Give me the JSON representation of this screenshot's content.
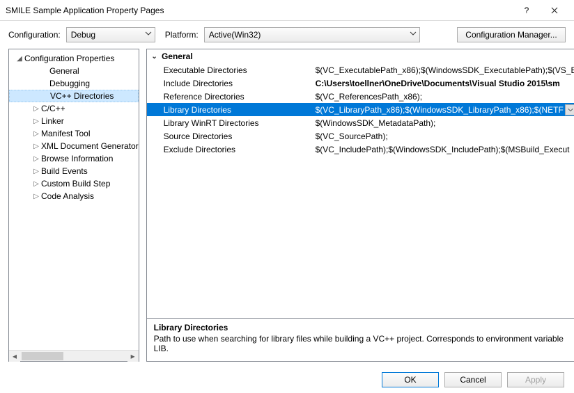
{
  "title": "SMILE Sample Application Property Pages",
  "toolbar": {
    "configuration_label": "Configuration:",
    "configuration_value": "Debug",
    "platform_label": "Platform:",
    "platform_value": "Active(Win32)",
    "config_manager": "Configuration Manager..."
  },
  "tree": {
    "root": "Configuration Properties",
    "items": [
      {
        "label": "General",
        "indent": 44,
        "glyph": ""
      },
      {
        "label": "Debugging",
        "indent": 44,
        "glyph": ""
      },
      {
        "label": "VC++ Directories",
        "indent": 44,
        "glyph": "",
        "selected": true
      },
      {
        "label": "C/C++",
        "indent": 32,
        "glyph": "▷"
      },
      {
        "label": "Linker",
        "indent": 32,
        "glyph": "▷"
      },
      {
        "label": "Manifest Tool",
        "indent": 32,
        "glyph": "▷"
      },
      {
        "label": "XML Document Generator",
        "indent": 32,
        "glyph": "▷"
      },
      {
        "label": "Browse Information",
        "indent": 32,
        "glyph": "▷"
      },
      {
        "label": "Build Events",
        "indent": 32,
        "glyph": "▷"
      },
      {
        "label": "Custom Build Step",
        "indent": 32,
        "glyph": "▷"
      },
      {
        "label": "Code Analysis",
        "indent": 32,
        "glyph": "▷"
      }
    ]
  },
  "grid": {
    "section": "General",
    "rows": [
      {
        "name": "Executable Directories",
        "value": "$(VC_ExecutablePath_x86);$(WindowsSDK_ExecutablePath);$(VS_E"
      },
      {
        "name": "Include Directories",
        "value": "C:\\Users\\toellner\\OneDrive\\Documents\\Visual Studio 2015\\sm",
        "bold": true
      },
      {
        "name": "Reference Directories",
        "value": "$(VC_ReferencesPath_x86);"
      },
      {
        "name": "Library Directories",
        "value": "$(VC_LibraryPath_x86);$(WindowsSDK_LibraryPath_x86);$(NETF",
        "selected": true
      },
      {
        "name": "Library WinRT Directories",
        "value": "$(WindowsSDK_MetadataPath);"
      },
      {
        "name": "Source Directories",
        "value": "$(VC_SourcePath);"
      },
      {
        "name": "Exclude Directories",
        "value": "$(VC_IncludePath);$(WindowsSDK_IncludePath);$(MSBuild_Execut"
      }
    ]
  },
  "description": {
    "title": "Library Directories",
    "text": "Path to use when searching for library files while building a VC++ project.  Corresponds to environment variable LIB."
  },
  "footer": {
    "ok": "OK",
    "cancel": "Cancel",
    "apply": "Apply"
  }
}
